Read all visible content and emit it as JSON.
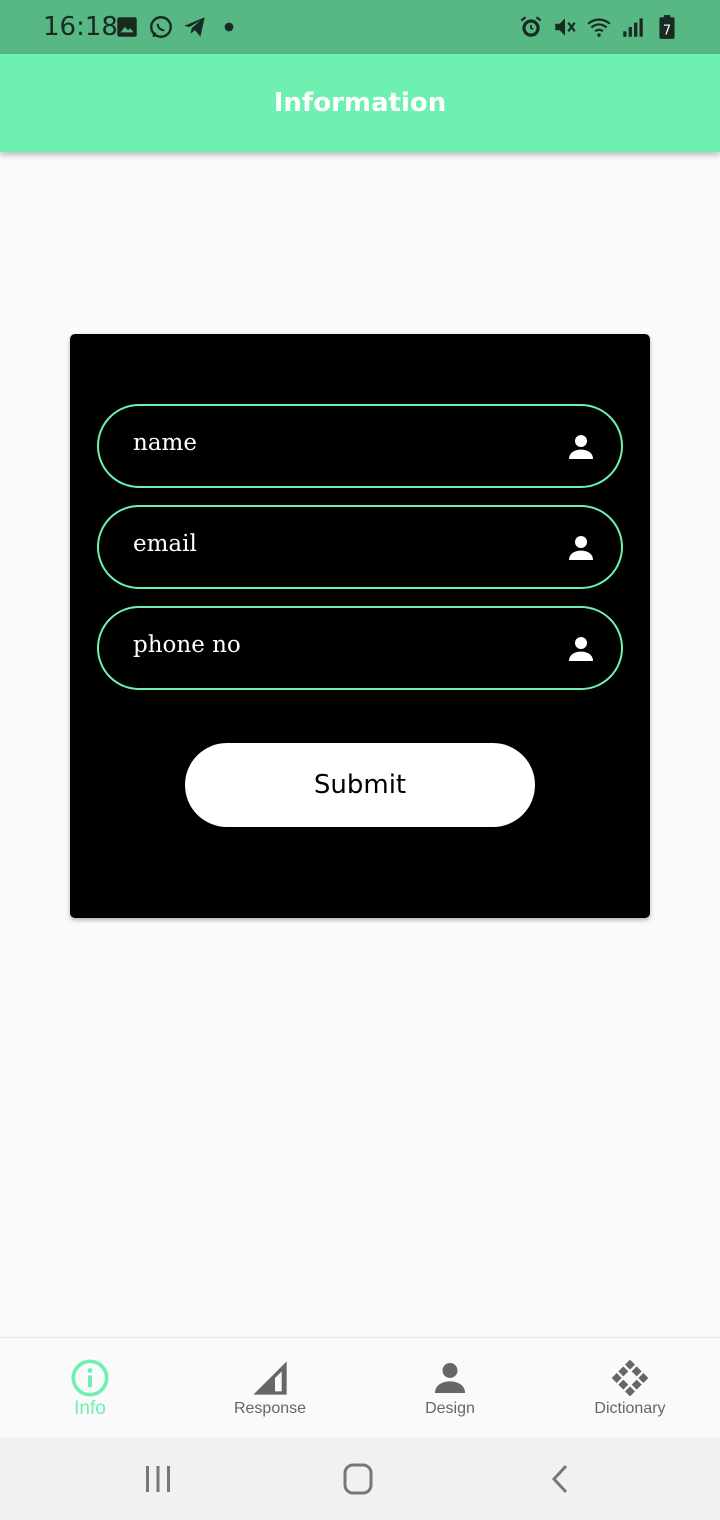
{
  "status_bar": {
    "time": "16:18",
    "left_icons": [
      "image-icon",
      "whatsapp-icon",
      "telegram-icon",
      "dot-icon"
    ],
    "right_icons": [
      "alarm-icon",
      "mute-icon",
      "wifi-icon",
      "signal-icon",
      "battery-icon"
    ],
    "battery_level": "7"
  },
  "app_bar": {
    "title": "Information"
  },
  "form": {
    "fields": [
      {
        "placeholder": "name",
        "icon": "person-icon"
      },
      {
        "placeholder": "email",
        "icon": "person-icon"
      },
      {
        "placeholder": "phone no",
        "icon": "person-icon"
      }
    ],
    "submit_label": "Submit"
  },
  "bottom_nav": {
    "items": [
      {
        "label": "Info",
        "icon": "info-icon",
        "active": true
      },
      {
        "label": "Response",
        "icon": "signal-triangle-icon",
        "active": false
      },
      {
        "label": "Design",
        "icon": "person-icon",
        "active": false
      },
      {
        "label": "Dictionary",
        "icon": "diamond-grid-icon",
        "active": false
      }
    ]
  },
  "colors": {
    "accent": "#6df0b0",
    "status_bar": "#57b884",
    "card": "#000000",
    "inactive_nav": "#666666"
  }
}
